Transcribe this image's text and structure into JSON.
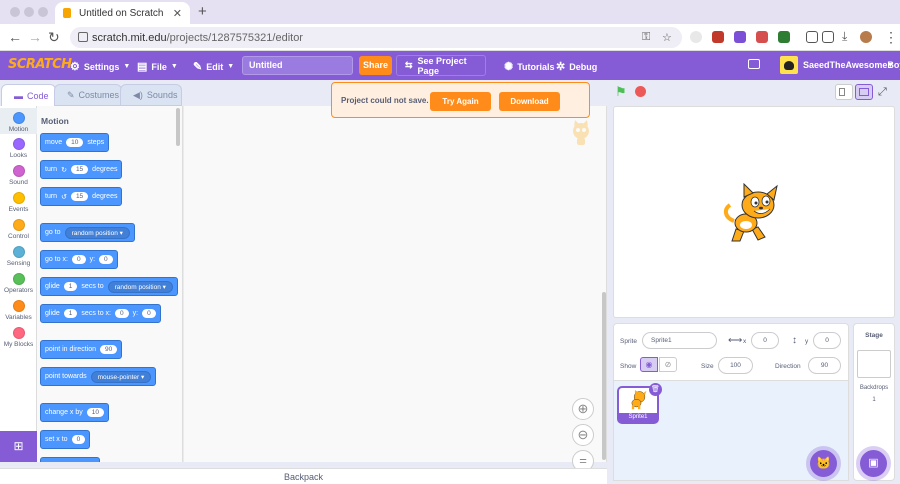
{
  "browser": {
    "tab_title": "Untitled on Scratch",
    "url_domain": "scratch.mit.edu",
    "url_path": "/projects/1287575321/editor"
  },
  "menubar": {
    "logo": "SCRATCH",
    "settings": "Settings",
    "file": "File",
    "edit": "Edit",
    "project_title": "Untitled",
    "share": "Share",
    "see_project_page": "See Project Page",
    "tutorials": "Tutorials",
    "debug": "Debug",
    "username": "SaeedTheAwesomeBoy"
  },
  "tabs": {
    "code": "Code",
    "costumes": "Costumes",
    "sounds": "Sounds"
  },
  "categories": [
    {
      "label": "Motion",
      "color": "#4c97ff"
    },
    {
      "label": "Looks",
      "color": "#9966ff"
    },
    {
      "label": "Sound",
      "color": "#cf63cf"
    },
    {
      "label": "Events",
      "color": "#ffbf00"
    },
    {
      "label": "Control",
      "color": "#ffab19"
    },
    {
      "label": "Sensing",
      "color": "#5cb1d6"
    },
    {
      "label": "Operators",
      "color": "#59c059"
    },
    {
      "label": "Variables",
      "color": "#ff8c1a"
    },
    {
      "label": "My Blocks",
      "color": "#ff6680"
    }
  ],
  "palette": {
    "title": "Motion",
    "move": {
      "a": "move",
      "v": "10",
      "b": "steps"
    },
    "turn_right": {
      "a": "turn",
      "icon": "↻",
      "v": "15",
      "b": "degrees"
    },
    "turn_left": {
      "a": "turn",
      "icon": "↺",
      "v": "15",
      "b": "degrees"
    },
    "goto": {
      "a": "go to",
      "dd": "random position ▾"
    },
    "goto_xy": {
      "a": "go to x:",
      "x": "0",
      "b": "y:",
      "y": "0"
    },
    "glide_to": {
      "a": "glide",
      "v": "1",
      "b": "secs to",
      "dd": "random position ▾"
    },
    "glide_xy": {
      "a": "glide",
      "v": "1",
      "b": "secs to x:",
      "x": "0",
      "c": "y:",
      "y": "0"
    },
    "point_dir": {
      "a": "point in direction",
      "v": "90"
    },
    "point_towards": {
      "a": "point towards",
      "dd": "mouse-pointer ▾"
    },
    "change_x": {
      "a": "change x by",
      "v": "10"
    },
    "set_x": {
      "a": "set x to",
      "v": "0"
    }
  },
  "alert": {
    "message": "Project could not save.",
    "try_again": "Try Again",
    "download": "Download"
  },
  "backpack": "Backpack",
  "sprite_info": {
    "sprite_label": "Sprite",
    "sprite_name": "Sprite1",
    "x_label": "x",
    "x": "0",
    "y_label": "y",
    "y": "0",
    "show_label": "Show",
    "size_label": "Size",
    "size": "100",
    "direction_label": "Direction",
    "direction": "90"
  },
  "sprites": [
    {
      "name": "Sprite1"
    }
  ],
  "stage_panel": {
    "title": "Stage",
    "backdrops_label": "Backdrops",
    "backdrops_count": "1"
  },
  "colors": {
    "accent": "#855cd6",
    "motion": "#4c97ff",
    "alert_orange": "#ff8c1a"
  }
}
